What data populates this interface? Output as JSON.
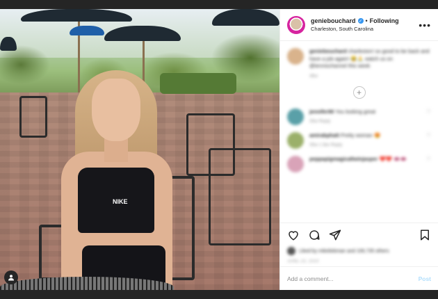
{
  "post": {
    "username": "geniebouchard",
    "separator": "•",
    "follow_status": "Following",
    "location": "Charleston, South Carolina",
    "more_icon": "more-horizontal-icon",
    "photo_brand_text": "NIKE"
  },
  "comments": [
    {
      "user": "geniebouchard",
      "text": "charleston! so good to be back and have a job again! 😂🙏 watch us on @tennischannel this week",
      "meta": "36w",
      "avatar_color": "#d9b38c"
    },
    {
      "user": "jennifer90",
      "text": "You looking great",
      "meta": "35w   Reply",
      "avatar_color": "#5aa0a8"
    },
    {
      "user": "amirabphatt",
      "text": "Pretty woman 😍",
      "meta": "35w   1 like   Reply",
      "avatar_color": "#9bb06a"
    },
    {
      "user": "peppapigmagicaltwinjasper",
      "text": "❤️❤️ 👄👄",
      "meta": "",
      "avatar_color": "#d9a3b8"
    }
  ],
  "actions": {
    "like_icon": "heart-icon",
    "comment_icon": "comment-icon",
    "share_icon": "share-icon",
    "save_icon": "bookmark-icon",
    "likes_text": "Liked by mikeliebman and 106,735 others",
    "date": "JUNE 23, 2020"
  },
  "add_comment": {
    "placeholder": "Add a comment...",
    "post_label": "Post"
  },
  "colors": {
    "verified": "#3897f0",
    "post_button": "#b2dffc",
    "story_ring": "#d6249f"
  }
}
